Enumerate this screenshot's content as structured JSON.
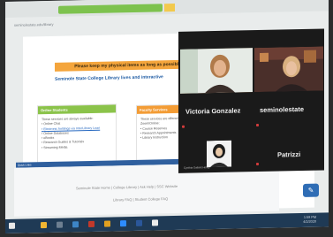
{
  "browser": {
    "top_banner": "",
    "url_text": "seminolestate.edu/library"
  },
  "page": {
    "notice": "Please keep my physical items as long as possible",
    "heading": "Seminole State College Library lives and interactive",
    "card_students": {
      "title": "Online Students",
      "intro": "These services are always available:",
      "items": [
        "Online Chat",
        "Electronic holdings via InterLibrary Loan",
        "Online Databases",
        "eBooks",
        "Research Guides & Tutorials",
        "Streaming Media"
      ]
    },
    "card_faculty": {
      "title": "Faculty Services",
      "intro": "These services are offered by",
      "sub": "Zoom/Online:",
      "items": [
        "Course Reserves",
        "Research Appointments",
        "Library Instruction"
      ]
    },
    "quick_links": "Quick Links",
    "footer_line1": "Seminole State Home | College Library | Ask Help | SSC Website",
    "footer_line2": "Library FAQ | Student College FAQ"
  },
  "zoom": {
    "participants": [
      {
        "name": "Victoria Gonzalez"
      },
      {
        "name": "seminolestate"
      },
      {
        "name": "Patrizzi"
      }
    ],
    "self_caption": "Cynthia Gallant Hollay"
  },
  "chat_icon": "chat-icon",
  "taskbar": {
    "time": "1:59 PM",
    "date": "4/2/2020"
  },
  "colors": {
    "green_accent": "#8bc34a",
    "orange_accent": "#f39c35",
    "blue_bar": "#2f5f9e",
    "taskbar": "#1f3a55"
  }
}
